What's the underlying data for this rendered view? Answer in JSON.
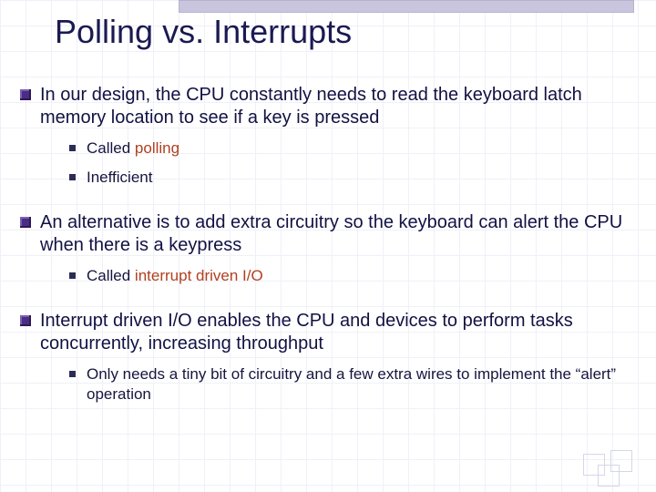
{
  "title": "Polling vs. Interrupts",
  "bullets": [
    {
      "text": "In our design, the CPU constantly needs to read the keyboard latch memory location to see if a key is pressed",
      "sub": [
        {
          "pre": "Called ",
          "red": "polling",
          "post": ""
        },
        {
          "pre": "Inefficient",
          "red": "",
          "post": ""
        }
      ]
    },
    {
      "text": "An alternative is to add extra circuitry so the keyboard can alert the CPU when there is a keypress",
      "sub": [
        {
          "pre": "Called ",
          "red": "interrupt driven I/O",
          "post": ""
        }
      ]
    },
    {
      "text": "Interrupt driven I/O enables the CPU and devices to perform tasks concurrently, increasing throughput",
      "sub": [
        {
          "pre": "Only needs a tiny bit of circuitry and a few extra wires to implement the “alert” operation",
          "red": "",
          "post": ""
        }
      ]
    }
  ]
}
